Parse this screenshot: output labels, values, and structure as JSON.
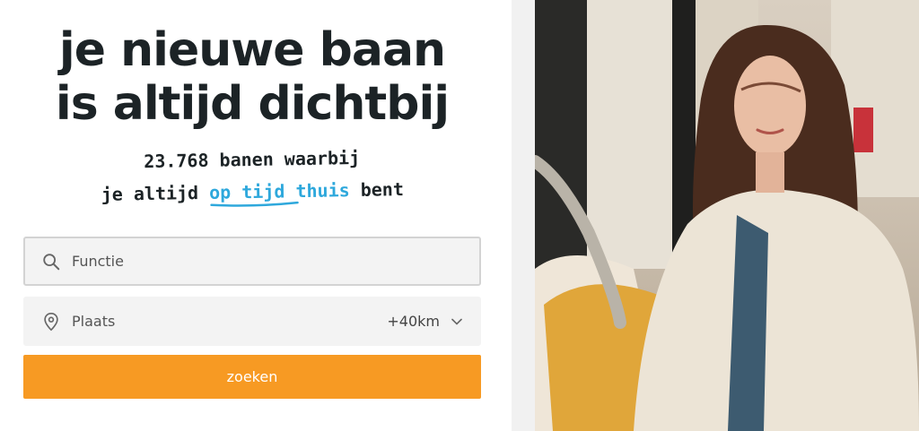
{
  "hero": {
    "headline_line1": "je nieuwe baan",
    "headline_line2": "is altijd dichtbij",
    "tagline_line1": "23.768 banen waarbij",
    "tagline_pre": "je altijd ",
    "tagline_highlight": "op tijd thuis",
    "tagline_post": " bent"
  },
  "search": {
    "function_placeholder": "Functie",
    "place_placeholder": "Plaats",
    "radius": "+40km",
    "submit_label": "zoeken"
  },
  "colors": {
    "accent_orange": "#f79a23",
    "highlight_blue": "#2ea8dc",
    "text_dark": "#1c2326"
  },
  "icons": [
    "search-icon",
    "location-pin-icon",
    "chevron-down-icon"
  ]
}
